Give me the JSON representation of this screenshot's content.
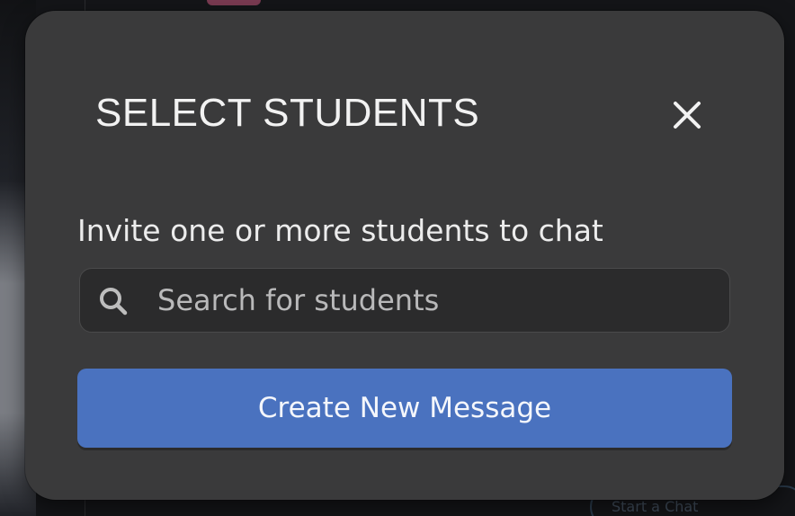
{
  "background": {
    "partial_pill_text": "Start a Chat"
  },
  "modal": {
    "title": "SELECT STUDENTS",
    "close_icon": "close-icon",
    "subtitle": "Invite one or more students to chat",
    "search": {
      "icon": "search-icon",
      "placeholder": "Search for students",
      "value": ""
    },
    "create_button_label": "Create New Message"
  },
  "colors": {
    "modal_bg": "#3a3a3b",
    "search_bg": "#2b2b2c",
    "button_accent": "#4a72bf",
    "text_primary": "#f2f2f2"
  }
}
